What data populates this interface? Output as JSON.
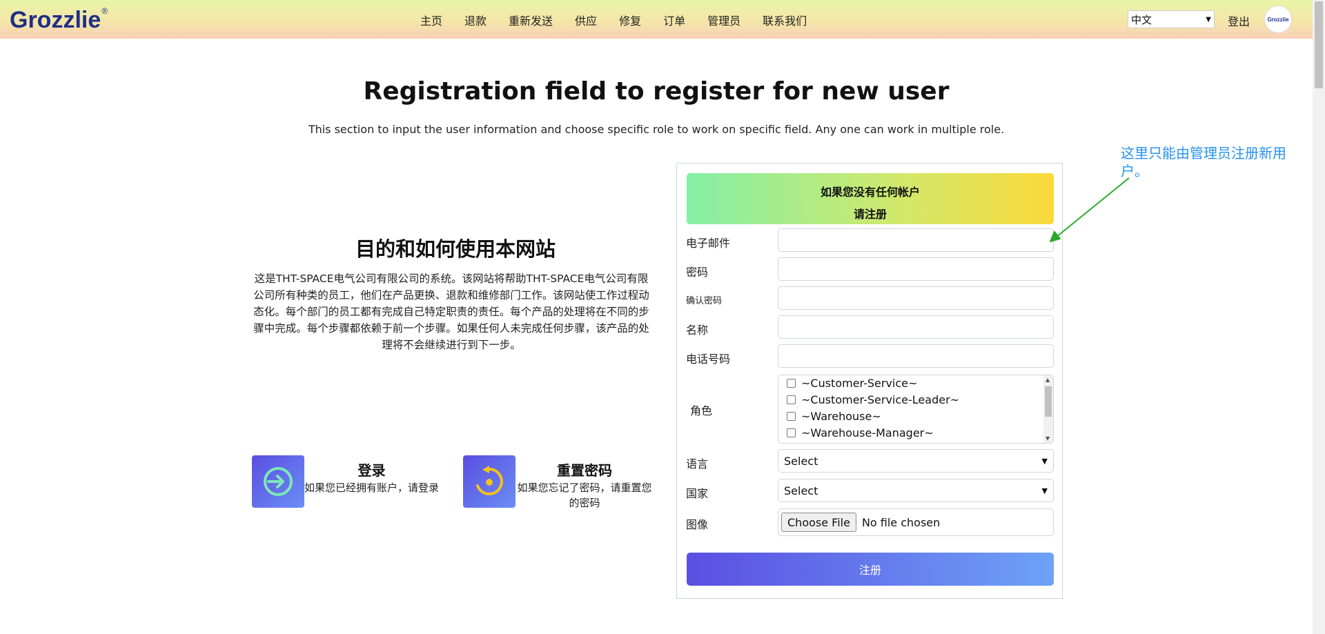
{
  "header": {
    "logo_text": "Grozzlie",
    "logo_mark": "®",
    "nav": [
      "主页",
      "退款",
      "重新发送",
      "供应",
      "修复",
      "订单",
      "管理员",
      "联系我们"
    ],
    "language_selected": "中文",
    "logout_label": "登出",
    "avatar_text": "Grozzlie"
  },
  "page": {
    "title": "Registration field to register for new user",
    "subtitle": "This section to input the user information and choose specific role to work on specific field. Any one can work in multiple role."
  },
  "purpose": {
    "title": "目的和如何使用本网站",
    "text": "这是THT-SPACE电气公司有限公司的系统。该网站将帮助THT-SPACE电气公司有限公司所有种类的员工，他们在产品更换、退款和维修部门工作。该网站使工作过程动态化。每个部门的员工都有完成自己特定职责的责任。每个产品的处理将在不同的步骤中完成。每个步骤都依赖于前一个步骤。如果任何人未完成任何步骤，该产品的处理将不会继续进行到下一步。"
  },
  "cards": {
    "login": {
      "title": "登录",
      "text": "如果您已经拥有账户，请登录",
      "icon": "login-arrow-icon"
    },
    "reset": {
      "title": "重置密码",
      "text": "如果您忘记了密码，请重置您的密码",
      "icon": "reset-password-icon"
    }
  },
  "form": {
    "banner_line1": "如果您没有任何帐户",
    "banner_line2": "请注册",
    "email_label": "电子邮件",
    "password_label": "密码",
    "confirm_label": "确认密码",
    "name_label": "名称",
    "phone_label": "电话号码",
    "role_label": "角色",
    "roles": [
      "~Customer-Service~",
      "~Customer-Service-Leader~",
      "~Warehouse~",
      "~Warehouse-Manager~"
    ],
    "language_label": "语言",
    "language_value": "Select",
    "country_label": "国家",
    "country_value": "Select",
    "image_label": "图像",
    "file_button": "Choose File",
    "file_status": "No file chosen",
    "submit_label": "注册"
  },
  "annotation": {
    "text": "这里只能由管理员注册新用户。",
    "color": "#2592f0"
  },
  "colors": {
    "brand": "#1e2f86",
    "submit_start": "#5a4fe2",
    "submit_end": "#6ea2f7",
    "arrow": "#2aaa2a"
  }
}
